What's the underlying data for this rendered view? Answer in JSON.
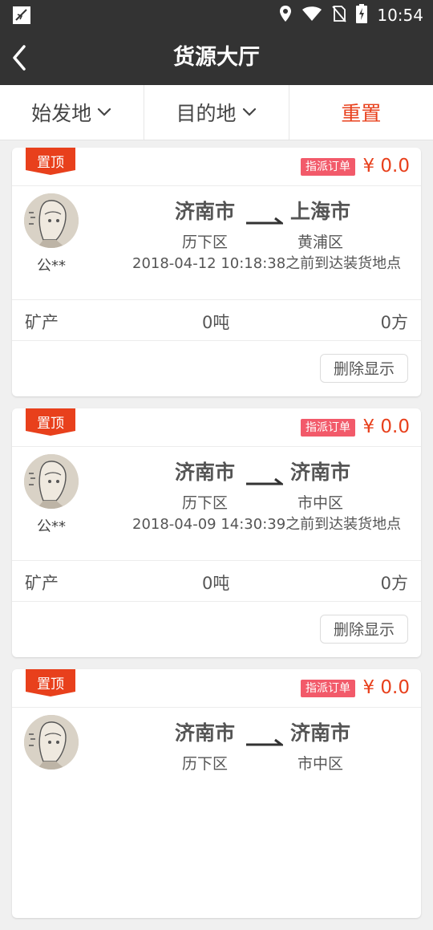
{
  "status_bar": {
    "time": "10:54",
    "icons": [
      "app-icon",
      "location-icon",
      "wifi-icon",
      "no-sim-icon",
      "battery-charging-icon"
    ]
  },
  "header": {
    "title": "货源大厅",
    "back_icon": "chevron-left-icon"
  },
  "filters": {
    "origin_label": "始发地",
    "destination_label": "目的地",
    "reset_label": "重置"
  },
  "colors": {
    "bar": "#333333",
    "accent": "#e8401c",
    "assign_badge": "#f25a6a"
  },
  "orders": [
    {
      "pin_label": "置顶",
      "assign_label": "指派订单",
      "price": "¥ 0.0",
      "shipper": "公**",
      "from_city": "济南市",
      "from_district": "历下区",
      "to_city": "上海市",
      "to_district": "黄浦区",
      "deadline": "2018-04-12 10:18:38之前到达装货地点",
      "cargo_name": "矿产",
      "cargo_weight": "0吨",
      "cargo_volume": "0方",
      "delete_label": "删除显示"
    },
    {
      "pin_label": "置顶",
      "assign_label": "指派订单",
      "price": "¥ 0.0",
      "shipper": "公**",
      "from_city": "济南市",
      "from_district": "历下区",
      "to_city": "济南市",
      "to_district": "市中区",
      "deadline": "2018-04-09 14:30:39之前到达装货地点",
      "cargo_name": "矿产",
      "cargo_weight": "0吨",
      "cargo_volume": "0方",
      "delete_label": "删除显示"
    },
    {
      "pin_label": "置顶",
      "assign_label": "指派订单",
      "price": "¥ 0.0",
      "from_city": "济南市",
      "from_district": "历下区",
      "to_city": "济南市",
      "to_district": "市中区"
    }
  ]
}
